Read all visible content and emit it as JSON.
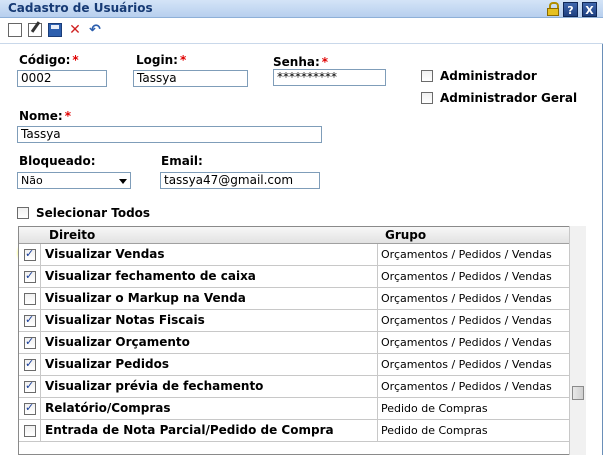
{
  "window": {
    "title": "Cadastro de Usuários",
    "help_label": "?",
    "close_label": "X"
  },
  "toolbar": {
    "icons": [
      "new-icon",
      "edit-icon",
      "save-icon",
      "delete-icon",
      "undo-icon"
    ]
  },
  "form": {
    "codigo_label": "Código:",
    "codigo_value": "0002",
    "login_label": "Login:",
    "login_value": "Tassya",
    "senha_label": "Senha:",
    "senha_value": "**********",
    "required_mark": "*",
    "admin_label": "Administrador",
    "admin_geral_label": "Administrador Geral",
    "nome_label": "Nome:",
    "nome_value": "Tassya",
    "bloqueado_label": "Bloqueado:",
    "bloqueado_value": "Não",
    "email_label": "Email:",
    "email_value": "tassya47@gmail.com",
    "selecionar_todos_label": "Selecionar Todos"
  },
  "grid": {
    "col_direito": "Direito",
    "col_grupo": "Grupo",
    "rows": [
      {
        "direito": "Visualizar Vendas",
        "grupo": "Orçamentos / Pedidos / Vendas",
        "checked": true
      },
      {
        "direito": "Visualizar fechamento de caixa",
        "grupo": "Orçamentos / Pedidos / Vendas",
        "checked": true
      },
      {
        "direito": "Visualizar o Markup na Venda",
        "grupo": "Orçamentos / Pedidos / Vendas",
        "checked": false
      },
      {
        "direito": "Visualizar Notas Fiscais",
        "grupo": "Orçamentos / Pedidos / Vendas",
        "checked": true
      },
      {
        "direito": "Visualizar Orçamento",
        "grupo": "Orçamentos / Pedidos / Vendas",
        "checked": true
      },
      {
        "direito": "Visualizar Pedidos",
        "grupo": "Orçamentos / Pedidos / Vendas",
        "checked": true
      },
      {
        "direito": "Visualizar prévia de fechamento",
        "grupo": "Orçamentos / Pedidos / Vendas",
        "checked": true
      },
      {
        "direito": "Relatório/Compras",
        "grupo": "Pedido de Compras",
        "checked": true
      },
      {
        "direito": "Entrada de Nota Parcial/Pedido de Compra",
        "grupo": "Pedido de Compras",
        "checked": false
      }
    ]
  },
  "colors": {
    "highlight": "#f5f500",
    "title_text": "#163a74",
    "required": "#e00000"
  }
}
